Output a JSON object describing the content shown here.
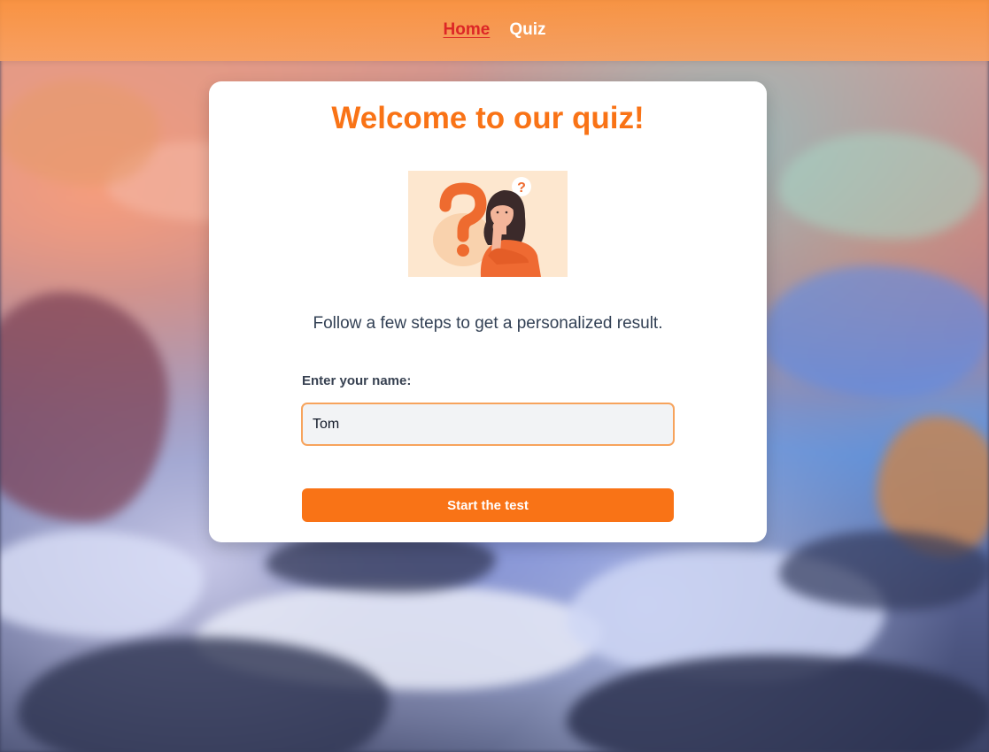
{
  "nav": {
    "items": [
      {
        "label": "Home",
        "active": true
      },
      {
        "label": "Quiz",
        "active": false
      }
    ]
  },
  "card": {
    "title": "Welcome to our quiz!",
    "illustration_icon": "thinking-woman-question-marks",
    "subtitle": "Follow a few steps to get a personalized result.",
    "name_label": "Enter your name:",
    "name_value": "Tom",
    "start_label": "Start the test"
  },
  "colors": {
    "accent": "#f97316",
    "active_nav": "#dc2626",
    "nav_bar": "#fb923c",
    "card_bg": "#ffffff",
    "input_bg": "#f2f3f5",
    "input_border": "#f7a35c"
  }
}
